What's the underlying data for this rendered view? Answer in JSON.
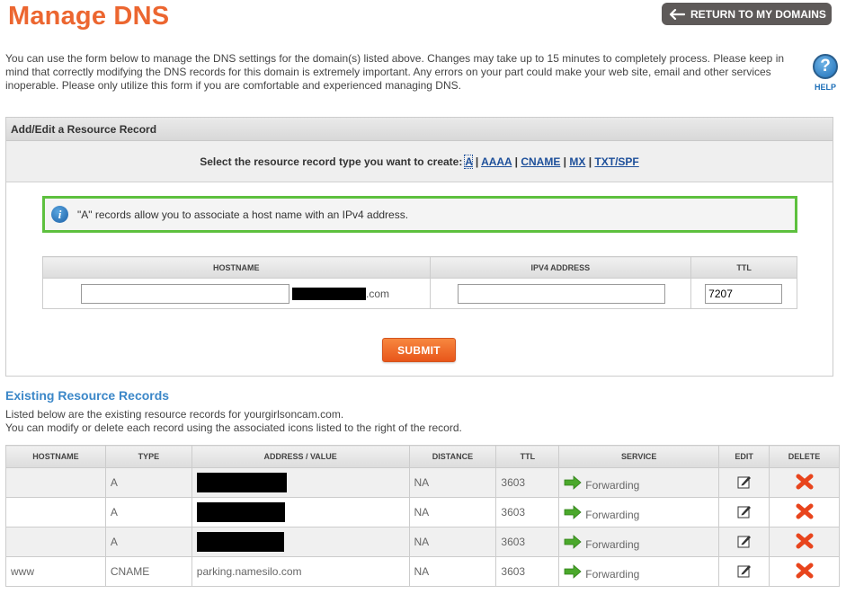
{
  "page": {
    "title": "Manage DNS",
    "return_button": "RETURN TO MY DOMAINS",
    "intro": "You can use the form below to manage the DNS settings for the domain(s) listed above. Changes may take up to 15 minutes to completely process. Please keep in mind that correctly modifying the DNS records for this domain is extremely important. Any errors on your part could make your web site, email and other services inoperable. Please only utilize this form if you are comfortable and experienced managing DNS.",
    "help_label": "HELP"
  },
  "form": {
    "panel_title": "Add/Edit a Resource Record",
    "select_prompt": "Select the resource record type you want to create:",
    "record_types": [
      "A",
      "AAAA",
      "CNAME",
      "MX",
      "TXT/SPF"
    ],
    "selected_type": "A",
    "info_text": "\"A\" records allow you to associate a host name with an IPv4 address.",
    "columns": [
      "HOSTNAME",
      "IPV4 ADDRESS",
      "TTL"
    ],
    "hostname_value": "",
    "domain_suffix": ".com",
    "ipv4_value": "",
    "ttl_value": "7207",
    "submit_label": "SUBMIT"
  },
  "existing": {
    "title": "Existing Resource Records",
    "line1": "Listed below are the existing resource records for yourgirlsoncam.com.",
    "line2": "You can modify or delete each record using the associated icons listed to the right of the record.",
    "columns": [
      "HOSTNAME",
      "TYPE",
      "ADDRESS / VALUE",
      "DISTANCE",
      "TTL",
      "SERVICE",
      "EDIT",
      "DELETE"
    ],
    "rows": [
      {
        "hostname": "",
        "type": "A",
        "value": "",
        "redacted": true,
        "distance": "NA",
        "ttl": "3603",
        "service": "Forwarding"
      },
      {
        "hostname": "",
        "type": "A",
        "value": "",
        "redacted": true,
        "distance": "NA",
        "ttl": "3603",
        "service": "Forwarding"
      },
      {
        "hostname": "",
        "type": "A",
        "value": "",
        "redacted": true,
        "distance": "NA",
        "ttl": "3603",
        "service": "Forwarding"
      },
      {
        "hostname": "www",
        "type": "CNAME",
        "value": "parking.namesilo.com",
        "redacted": false,
        "distance": "NA",
        "ttl": "3603",
        "service": "Forwarding"
      }
    ]
  },
  "colors": {
    "title": "#ec6630",
    "link": "#1d4f9a",
    "info_border": "#5dc03e",
    "submit": "#e8561a",
    "section_title": "#3b87c8",
    "delete": "#e8441c",
    "arrow": "#4aa82b"
  },
  "icons": {
    "return": "left-arrow-icon",
    "help": "question-mark-icon",
    "info": "info-icon",
    "service": "green-right-arrow-icon",
    "edit": "pencil-edit-icon",
    "delete": "red-x-icon"
  }
}
